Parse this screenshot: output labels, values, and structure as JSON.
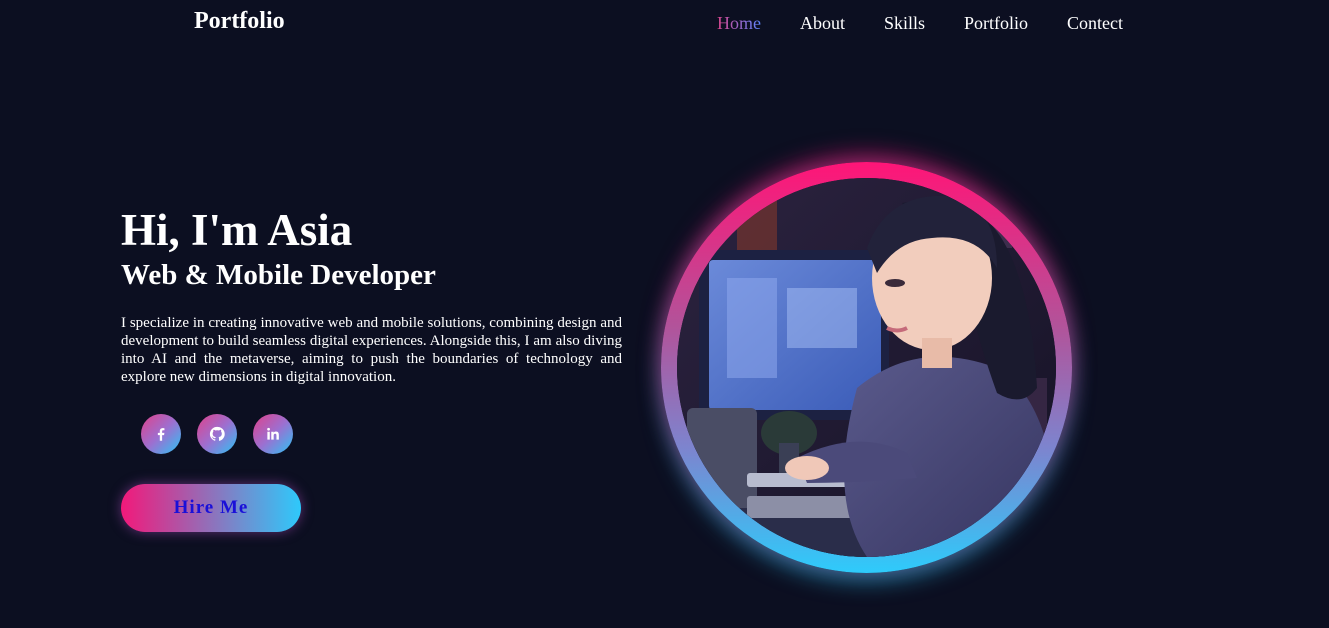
{
  "nav": {
    "logo": "Portfolio",
    "links": [
      "Home",
      "About",
      "Skills",
      "Portfolio",
      "Contect"
    ]
  },
  "hero": {
    "greeting": "Hi, I'm Asia",
    "role": "Web & Mobile Developer",
    "description": "I specialize in creating innovative web and mobile solutions, combining design and development to build seamless digital experiences. Alongside this, I am also diving into AI and the metaverse, aiming to push the boundaries of technology and explore new dimensions in digital innovation.",
    "hire_button": "Hire Me"
  },
  "social": [
    "facebook-icon",
    "github-icon",
    "linkedin-icon"
  ],
  "colors": {
    "background": "#0c0f21",
    "accent_pink": "#f2197a",
    "accent_blue": "#2ec9fb",
    "button_text": "#1a10d8"
  }
}
